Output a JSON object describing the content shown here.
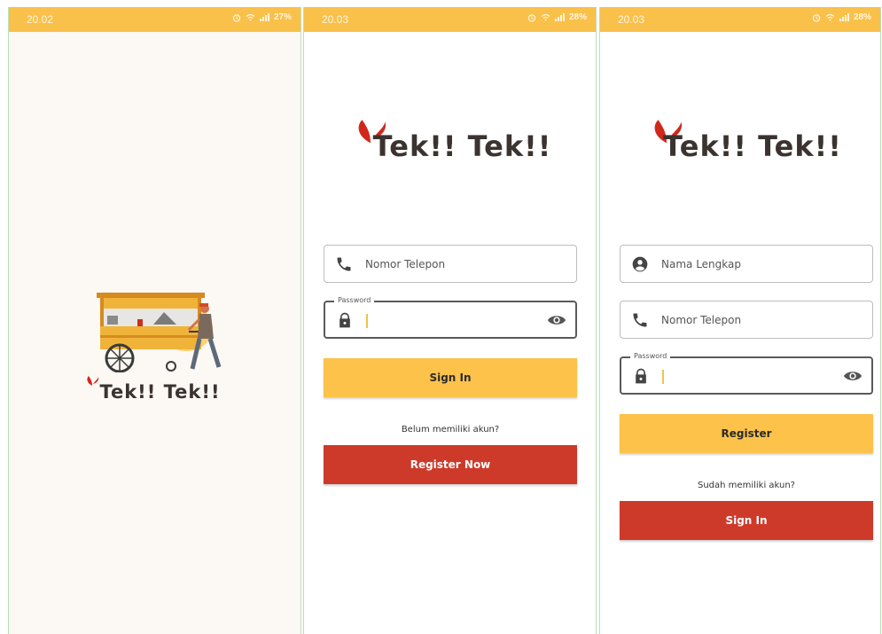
{
  "splash": {
    "status_time": "20.02",
    "battery": "27%",
    "brand": "Tek!! Tek!!"
  },
  "login": {
    "status_time": "20.03",
    "battery": "28%",
    "brand": "Tek!! Tek!!",
    "phone_placeholder": "Nomor Telepon",
    "password_label": "Password",
    "signin_label": "Sign In",
    "no_account_text": "Belum memiliki akun?",
    "register_now_label": "Register Now"
  },
  "register": {
    "status_time": "20.03",
    "battery": "28%",
    "brand": "Tek!! Tek!!",
    "name_placeholder": "Nama Lengkap",
    "phone_placeholder": "Nomor Telepon",
    "password_label": "Password",
    "register_label": "Register",
    "have_account_text": "Sudah memiliki akun?",
    "signin_label": "Sign In"
  },
  "colors": {
    "status_bar": "#f9c04a",
    "primary_yellow": "#fcc24a",
    "primary_red": "#cd3a2a",
    "brand_text": "#3b3330",
    "splash_bg": "#fcf8f4"
  },
  "icons": [
    "alarm-icon",
    "wifi-icon",
    "signal-icon",
    "phone-icon",
    "lock-icon",
    "eye-icon",
    "person-icon",
    "splash-drops-icon",
    "food-cart-illustration"
  ]
}
